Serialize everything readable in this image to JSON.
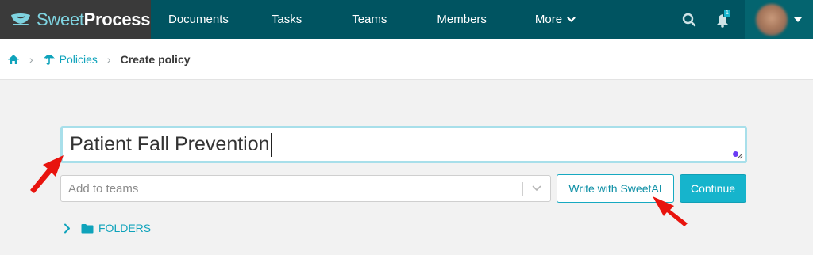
{
  "brand": {
    "name_light": "Sweet",
    "name_bold": "Process"
  },
  "nav": {
    "items": [
      {
        "label": "Documents"
      },
      {
        "label": "Tasks"
      },
      {
        "label": "Teams"
      },
      {
        "label": "Members"
      },
      {
        "label": "More"
      }
    ],
    "notification_count": "1",
    "icons": [
      "search-icon",
      "bell-icon",
      "chevron-down-icon"
    ]
  },
  "breadcrumb": {
    "home_icon": "home-icon",
    "policies_label": "Policies",
    "current_label": "Create policy"
  },
  "form": {
    "title_value": "Patient Fall Prevention",
    "teams_placeholder": "Add to teams",
    "sweetai_label": "Write with SweetAI",
    "continue_label": "Continue",
    "folders_label": "FOLDERS"
  },
  "colors": {
    "nav_bg": "#005461",
    "accent": "#16b4cc",
    "annotation_arrow": "#e8140e"
  }
}
